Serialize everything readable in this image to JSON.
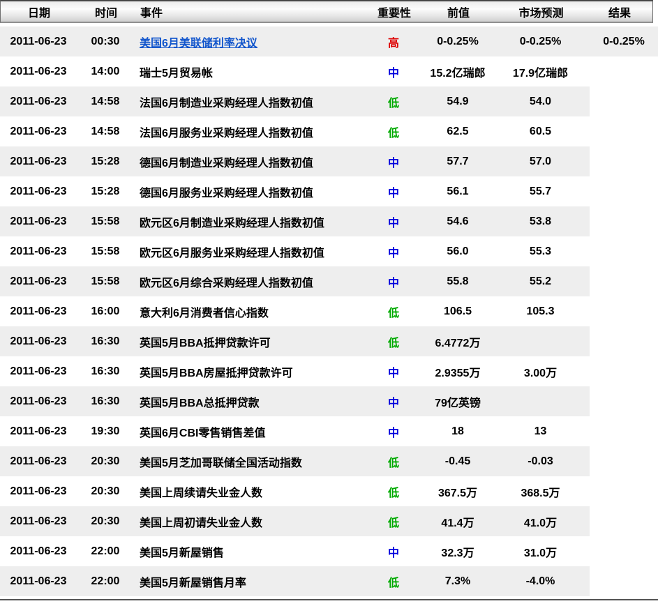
{
  "table": {
    "columns": [
      {
        "key": "date",
        "label": "日期"
      },
      {
        "key": "time",
        "label": "时间"
      },
      {
        "key": "event",
        "label": "事件"
      },
      {
        "key": "importance",
        "label": "重要性"
      },
      {
        "key": "previous",
        "label": "前值"
      },
      {
        "key": "forecast",
        "label": "市场预测"
      },
      {
        "key": "result",
        "label": "结果"
      }
    ],
    "importance_colors": {
      "高": "#dd0000",
      "中": "#0000dd",
      "低": "#00aa00"
    },
    "link_color": "#1155cc",
    "stripe_color": "#eeeeee",
    "rows": [
      {
        "date": "2011-06-23",
        "time": "00:30",
        "event": "美国6月美联储利率决议",
        "event_is_link": true,
        "importance": "高",
        "previous": "0-0.25%",
        "forecast": "0-0.25%",
        "result": "0-0.25%"
      },
      {
        "date": "2011-06-23",
        "time": "14:00",
        "event": "瑞士5月贸易帐",
        "event_is_link": false,
        "importance": "中",
        "previous": "15.2亿瑞郎",
        "forecast": "17.9亿瑞郎",
        "result": ""
      },
      {
        "date": "2011-06-23",
        "time": "14:58",
        "event": "法国6月制造业采购经理人指数初值",
        "event_is_link": false,
        "importance": "低",
        "previous": "54.9",
        "forecast": "54.0",
        "result": ""
      },
      {
        "date": "2011-06-23",
        "time": "14:58",
        "event": "法国6月服务业采购经理人指数初值",
        "event_is_link": false,
        "importance": "低",
        "previous": "62.5",
        "forecast": "60.5",
        "result": ""
      },
      {
        "date": "2011-06-23",
        "time": "15:28",
        "event": "德国6月制造业采购经理人指数初值",
        "event_is_link": false,
        "importance": "中",
        "previous": "57.7",
        "forecast": "57.0",
        "result": ""
      },
      {
        "date": "2011-06-23",
        "time": "15:28",
        "event": "德国6月服务业采购经理人指数初值",
        "event_is_link": false,
        "importance": "中",
        "previous": "56.1",
        "forecast": "55.7",
        "result": ""
      },
      {
        "date": "2011-06-23",
        "time": "15:58",
        "event": "欧元区6月制造业采购经理人指数初值",
        "event_is_link": false,
        "importance": "中",
        "previous": "54.6",
        "forecast": "53.8",
        "result": ""
      },
      {
        "date": "2011-06-23",
        "time": "15:58",
        "event": "欧元区6月服务业采购经理人指数初值",
        "event_is_link": false,
        "importance": "中",
        "previous": "56.0",
        "forecast": "55.3",
        "result": ""
      },
      {
        "date": "2011-06-23",
        "time": "15:58",
        "event": "欧元区6月综合采购经理人指数初值",
        "event_is_link": false,
        "importance": "中",
        "previous": "55.8",
        "forecast": "55.2",
        "result": ""
      },
      {
        "date": "2011-06-23",
        "time": "16:00",
        "event": "意大利6月消费者信心指数",
        "event_is_link": false,
        "importance": "低",
        "previous": "106.5",
        "forecast": "105.3",
        "result": ""
      },
      {
        "date": "2011-06-23",
        "time": "16:30",
        "event": "英国5月BBA抵押贷款许可",
        "event_is_link": false,
        "importance": "低",
        "previous": "6.4772万",
        "forecast": "",
        "result": ""
      },
      {
        "date": "2011-06-23",
        "time": "16:30",
        "event": "英国5月BBA房屋抵押贷款许可",
        "event_is_link": false,
        "importance": "中",
        "previous": "2.9355万",
        "forecast": "3.00万",
        "result": ""
      },
      {
        "date": "2011-06-23",
        "time": "16:30",
        "event": "英国5月BBA总抵押贷款",
        "event_is_link": false,
        "importance": "中",
        "previous": "79亿英镑",
        "forecast": "",
        "result": ""
      },
      {
        "date": "2011-06-23",
        "time": "19:30",
        "event": "英国6月CBI零售销售差值",
        "event_is_link": false,
        "importance": "中",
        "previous": "18",
        "forecast": "13",
        "result": ""
      },
      {
        "date": "2011-06-23",
        "time": "20:30",
        "event": "美国5月芝加哥联储全国活动指数",
        "event_is_link": false,
        "importance": "低",
        "previous": "-0.45",
        "forecast": "-0.03",
        "result": ""
      },
      {
        "date": "2011-06-23",
        "time": "20:30",
        "event": "美国上周续请失业金人数",
        "event_is_link": false,
        "importance": "低",
        "previous": "367.5万",
        "forecast": "368.5万",
        "result": ""
      },
      {
        "date": "2011-06-23",
        "time": "20:30",
        "event": "美国上周初请失业金人数",
        "event_is_link": false,
        "importance": "低",
        "previous": "41.4万",
        "forecast": "41.0万",
        "result": ""
      },
      {
        "date": "2011-06-23",
        "time": "22:00",
        "event": "美国5月新屋销售",
        "event_is_link": false,
        "importance": "中",
        "previous": "32.3万",
        "forecast": "31.0万",
        "result": ""
      },
      {
        "date": "2011-06-23",
        "time": "22:00",
        "event": "美国5月新屋销售月率",
        "event_is_link": false,
        "importance": "低",
        "previous": "7.3%",
        "forecast": "-4.0%",
        "result": ""
      }
    ]
  }
}
